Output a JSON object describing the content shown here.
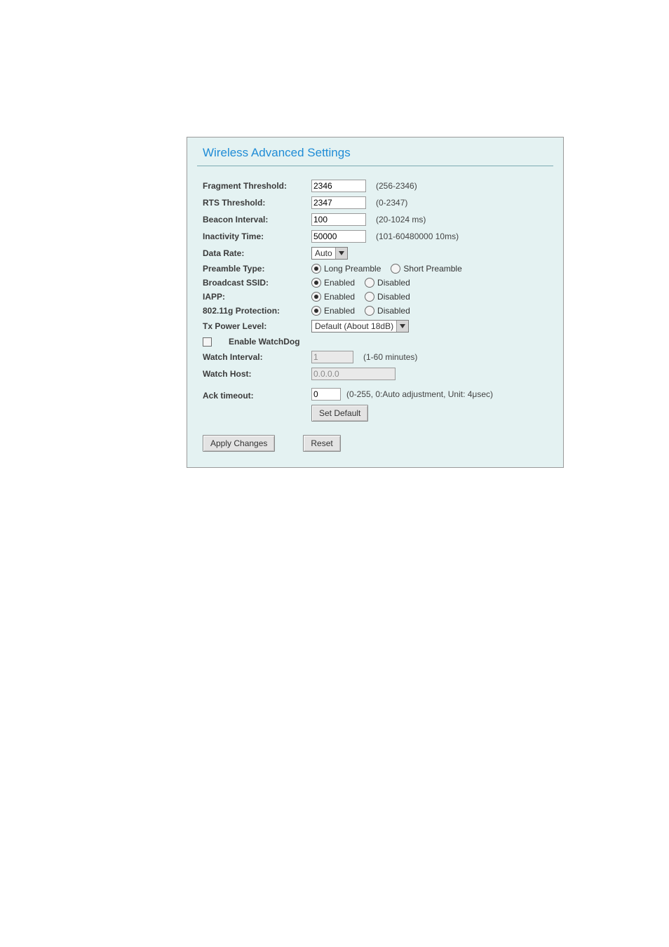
{
  "title": "Wireless Advanced Settings",
  "fields": {
    "fragment": {
      "label": "Fragment Threshold:",
      "value": "2346",
      "range": "(256-2346)"
    },
    "rts": {
      "label": "RTS Threshold:",
      "value": "2347",
      "range": "(0-2347)"
    },
    "beacon": {
      "label": "Beacon Interval:",
      "value": "100",
      "range": "(20-1024 ms)"
    },
    "inact": {
      "label": "Inactivity Time:",
      "value": "50000",
      "range": "(101-60480000 10ms)"
    },
    "dataRate": {
      "label": "Data Rate:",
      "value": "Auto"
    },
    "preamble": {
      "label": "Preamble Type:",
      "opt1": "Long Preamble",
      "opt2": "Short Preamble",
      "selected": "opt1"
    },
    "bssid": {
      "label": "Broadcast SSID:",
      "opt1": "Enabled",
      "opt2": "Disabled",
      "selected": "opt1"
    },
    "iapp": {
      "label": "IAPP:",
      "opt1": "Enabled",
      "opt2": "Disabled",
      "selected": "opt1"
    },
    "gprot": {
      "label": "802.11g Protection:",
      "opt1": "Enabled",
      "opt2": "Disabled",
      "selected": "opt1"
    },
    "txpower": {
      "label": "Tx Power Level:",
      "value": "Default (About 18dB)"
    },
    "watchdog": {
      "label": "Enable WatchDog",
      "checked": false
    },
    "winterval": {
      "label": "Watch Interval:",
      "value": "1",
      "range": "(1-60 minutes)"
    },
    "whost": {
      "label": "Watch Host:",
      "value": "0.0.0.0"
    },
    "ack": {
      "label": "Ack timeout:",
      "value": "0",
      "range": "(0-255, 0:Auto adjustment, Unit: 4μsec)",
      "setDefault": "Set Default"
    }
  },
  "buttons": {
    "apply": "Apply Changes",
    "reset": "Reset"
  }
}
